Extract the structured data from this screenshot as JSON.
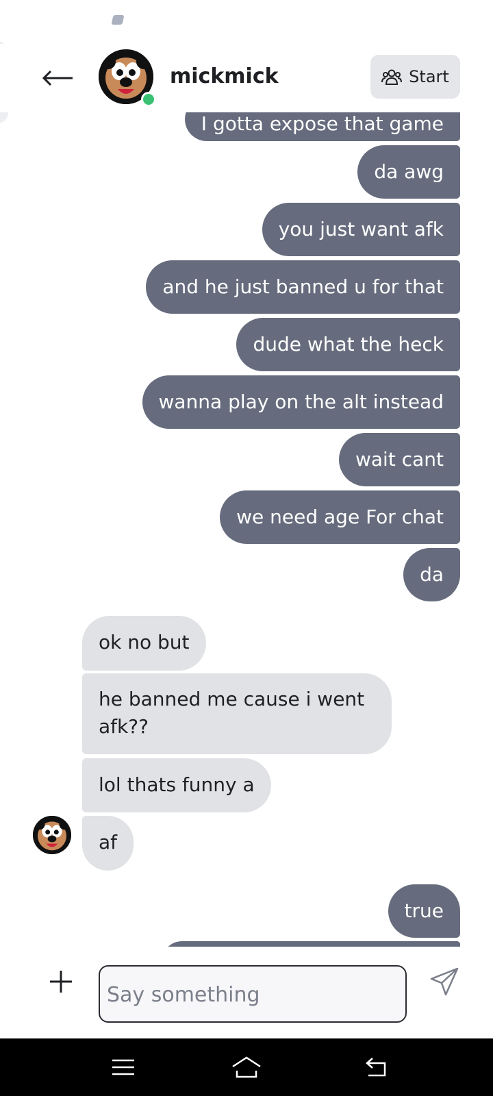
{
  "header": {
    "title": "mickmick",
    "start_label": "Start",
    "online": true
  },
  "messages": [
    {
      "dir": "out",
      "text": "I gotta expose that game"
    },
    {
      "dir": "out",
      "text": "da awg"
    },
    {
      "dir": "out",
      "text": "you just want afk"
    },
    {
      "dir": "out",
      "text": "and he just banned u for that"
    },
    {
      "dir": "out",
      "text": "dude what the heck"
    },
    {
      "dir": "out",
      "text": "wanna play on the alt instead"
    },
    {
      "dir": "out",
      "text": "wait cant"
    },
    {
      "dir": "out",
      "text": "we need age For chat"
    },
    {
      "dir": "out",
      "text": "da"
    },
    {
      "dir": "in",
      "text": "ok no but"
    },
    {
      "dir": "in",
      "text": "he banned me cause i went afk??"
    },
    {
      "dir": "in",
      "text": "lol thats funny a"
    },
    {
      "dir": "in",
      "text": "af"
    },
    {
      "dir": "out",
      "text": "true"
    }
  ],
  "composer": {
    "placeholder": "Say something"
  },
  "colors": {
    "outgoing_bubble": "#666c7d",
    "incoming_bubble": "#e1e2e5",
    "online": "#38c172"
  },
  "icons": {
    "back": "arrow-left-icon",
    "start": "people-icon",
    "plus": "plus-icon",
    "send": "paper-plane-icon",
    "nav_menu": "menu-icon",
    "nav_home": "home-icon",
    "nav_back": "back-icon"
  }
}
